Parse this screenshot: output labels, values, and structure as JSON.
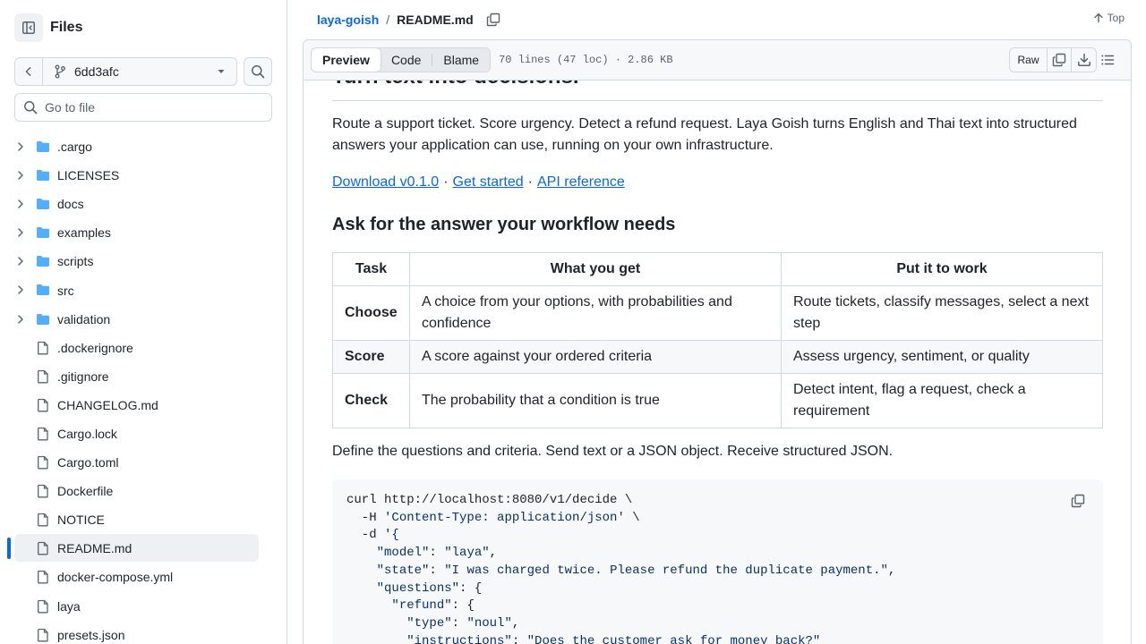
{
  "sidebar": {
    "title": "Files",
    "branch": "6dd3afc",
    "goto_placeholder": "Go to file",
    "items": [
      {
        "label": ".cargo",
        "type": "folder"
      },
      {
        "label": "LICENSES",
        "type": "folder"
      },
      {
        "label": "docs",
        "type": "folder"
      },
      {
        "label": "examples",
        "type": "folder"
      },
      {
        "label": "scripts",
        "type": "folder"
      },
      {
        "label": "src",
        "type": "folder"
      },
      {
        "label": "validation",
        "type": "folder"
      },
      {
        "label": ".dockerignore",
        "type": "file"
      },
      {
        "label": ".gitignore",
        "type": "file"
      },
      {
        "label": "CHANGELOG.md",
        "type": "file"
      },
      {
        "label": "Cargo.lock",
        "type": "file"
      },
      {
        "label": "Cargo.toml",
        "type": "file"
      },
      {
        "label": "Dockerfile",
        "type": "file"
      },
      {
        "label": "NOTICE",
        "type": "file"
      },
      {
        "label": "README.md",
        "type": "file",
        "active": true
      },
      {
        "label": "docker-compose.yml",
        "type": "file"
      },
      {
        "label": "laya",
        "type": "file"
      },
      {
        "label": "presets.json",
        "type": "file"
      }
    ]
  },
  "header": {
    "repo": "laya-goish",
    "separator": "/",
    "file": "README.md",
    "top_label": "Top"
  },
  "toolbar": {
    "tabs": [
      "Preview",
      "Code",
      "Blame"
    ],
    "active_tab": "Preview",
    "meta": "70 lines (47 loc) · 2.86 KB",
    "raw_label": "Raw"
  },
  "readme": {
    "h1": "Turn text into decisions.",
    "intro": "Route a support ticket. Score urgency. Detect a refund request. Laya Goish turns English and Thai text into structured answers your application can use, running on your own infrastructure.",
    "links": [
      "Download v0.1.0",
      "Get started",
      "API reference"
    ],
    "link_sep": "·",
    "h2": "Ask for the answer your workflow needs",
    "table": {
      "headers": [
        "Task",
        "What you get",
        "Put it to work"
      ],
      "rows": [
        [
          "Choose",
          "A choice from your options, with probabilities and confidence",
          "Route tickets, classify messages, select a next step"
        ],
        [
          "Score",
          "A score against your ordered criteria",
          "Assess urgency, sentiment, or quality"
        ],
        [
          "Check",
          "The probability that a condition is true",
          "Detect intent, flag a request, check a requirement"
        ]
      ]
    },
    "after_table": "Define the questions and criteria. Send text or a JSON object. Receive structured JSON.",
    "code_lines": [
      "curl http://localhost:8080/v1/decide \\",
      "  -H 'Content-Type: application/json' \\",
      "  -d '{",
      "    \"model\": \"laya\",",
      "    \"state\": \"I was charged twice. Please refund the duplicate payment.\",",
      "    \"questions\": {",
      "      \"refund\": {",
      "        \"type\": \"noul\",",
      "        \"instructions\": \"Does the customer ask for money back?\""
    ]
  },
  "colors": {
    "accent": "#0969da",
    "border": "#d1d9e0",
    "folder": "#54aeff",
    "muted": "#59636e"
  }
}
